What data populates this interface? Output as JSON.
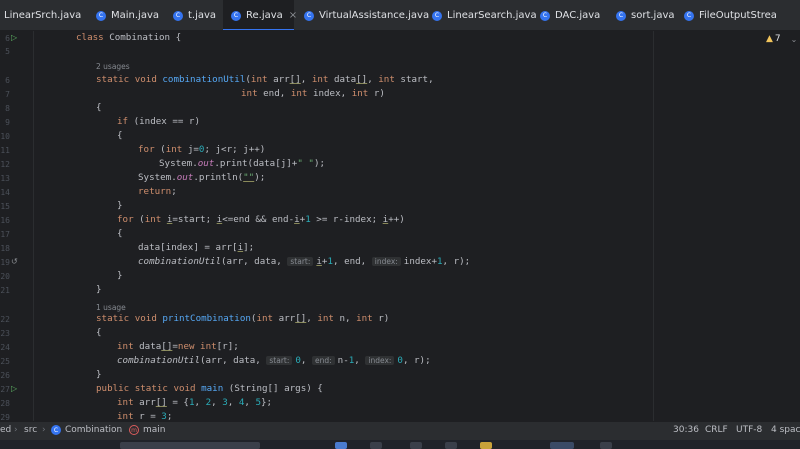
{
  "tabs": [
    {
      "label": "LinearSrch.java",
      "icon": "java-class-icon"
    },
    {
      "label": "Main.java",
      "icon": "java-class-icon"
    },
    {
      "label": "t.java",
      "icon": "java-class-icon"
    },
    {
      "label": "Re.java",
      "icon": "java-class-icon",
      "active": true,
      "close": "×"
    },
    {
      "label": "VirtualAssistance.java",
      "icon": "java-class-icon"
    },
    {
      "label": "LinearSearch.java",
      "icon": "java-class-icon"
    },
    {
      "label": "DAC.java",
      "icon": "java-class-icon"
    },
    {
      "label": "sort.java",
      "icon": "java-class-icon"
    },
    {
      "label": "FileOutputStrea",
      "icon": "java-class-icon"
    }
  ],
  "inspections": {
    "warning_count": "7",
    "icon": "warning-icon"
  },
  "line_numbers": [
    "6",
    "5",
    "",
    "6",
    "7",
    "8",
    "9",
    "10",
    "11",
    "12",
    "13",
    "14",
    "15",
    "16",
    "17",
    "18",
    "19",
    "20",
    "21",
    "",
    "22",
    "23",
    "24",
    "25",
    "26",
    "27",
    "28",
    "29"
  ],
  "hints": {
    "usages_2": "2 usages",
    "usages_1": "1 usage"
  },
  "code": {
    "class_decl": "class Combination {",
    "combUtil_sig1": "static void combinationUtil(int arr[], int data[], int start,",
    "combUtil_sig2": "int end, int index, int r)",
    "brace_open": "{",
    "brace_close": "}",
    "if_line": "if (index == r)",
    "for_j": "for (int j=0; j<r; j++)",
    "print_line": "System.out.print(data[j]+\" \");",
    "println_line": "System.out.println(\"\");",
    "return_line": "return;",
    "for_i": "for (int i=start; i<=end && end-i+1 >= r-index; i++)",
    "assign_line": "data[index] = arr[i];",
    "rec_call": "combinationUtil(arr, data, start: i+1, end, index: index+1, r);",
    "printComb_sig": "static void printCombination(int arr[], int n, int r)",
    "data_decl": "int data[]=new int[r];",
    "call_util": "combinationUtil(arr, data, start: 0, end: n-1, index: 0, r);",
    "main_sig": "public static void main (String[] args) {",
    "arr_decl": "int arr[] = {1, 2, 3, 4, 5};",
    "r_decl": "int r = 3;"
  },
  "param_hints": {
    "start": "start:",
    "end": "end:",
    "index": "index:"
  },
  "breadcrumbs": [
    {
      "label": "ed",
      "icon": ""
    },
    {
      "label": "src",
      "icon": ""
    },
    {
      "label": "Combination",
      "icon": "class-icon"
    },
    {
      "label": "main",
      "icon": "method-icon"
    }
  ],
  "status": {
    "position": "30:36",
    "line_sep": "CRLF",
    "encoding": "UTF-8",
    "indent": "4 spac"
  },
  "colors": {
    "accent": "#3574f0",
    "keyword": "#cf8e6d",
    "function": "#56a8f5",
    "number": "#2aacb8",
    "string": "#6aab73",
    "field": "#c77dbb"
  }
}
